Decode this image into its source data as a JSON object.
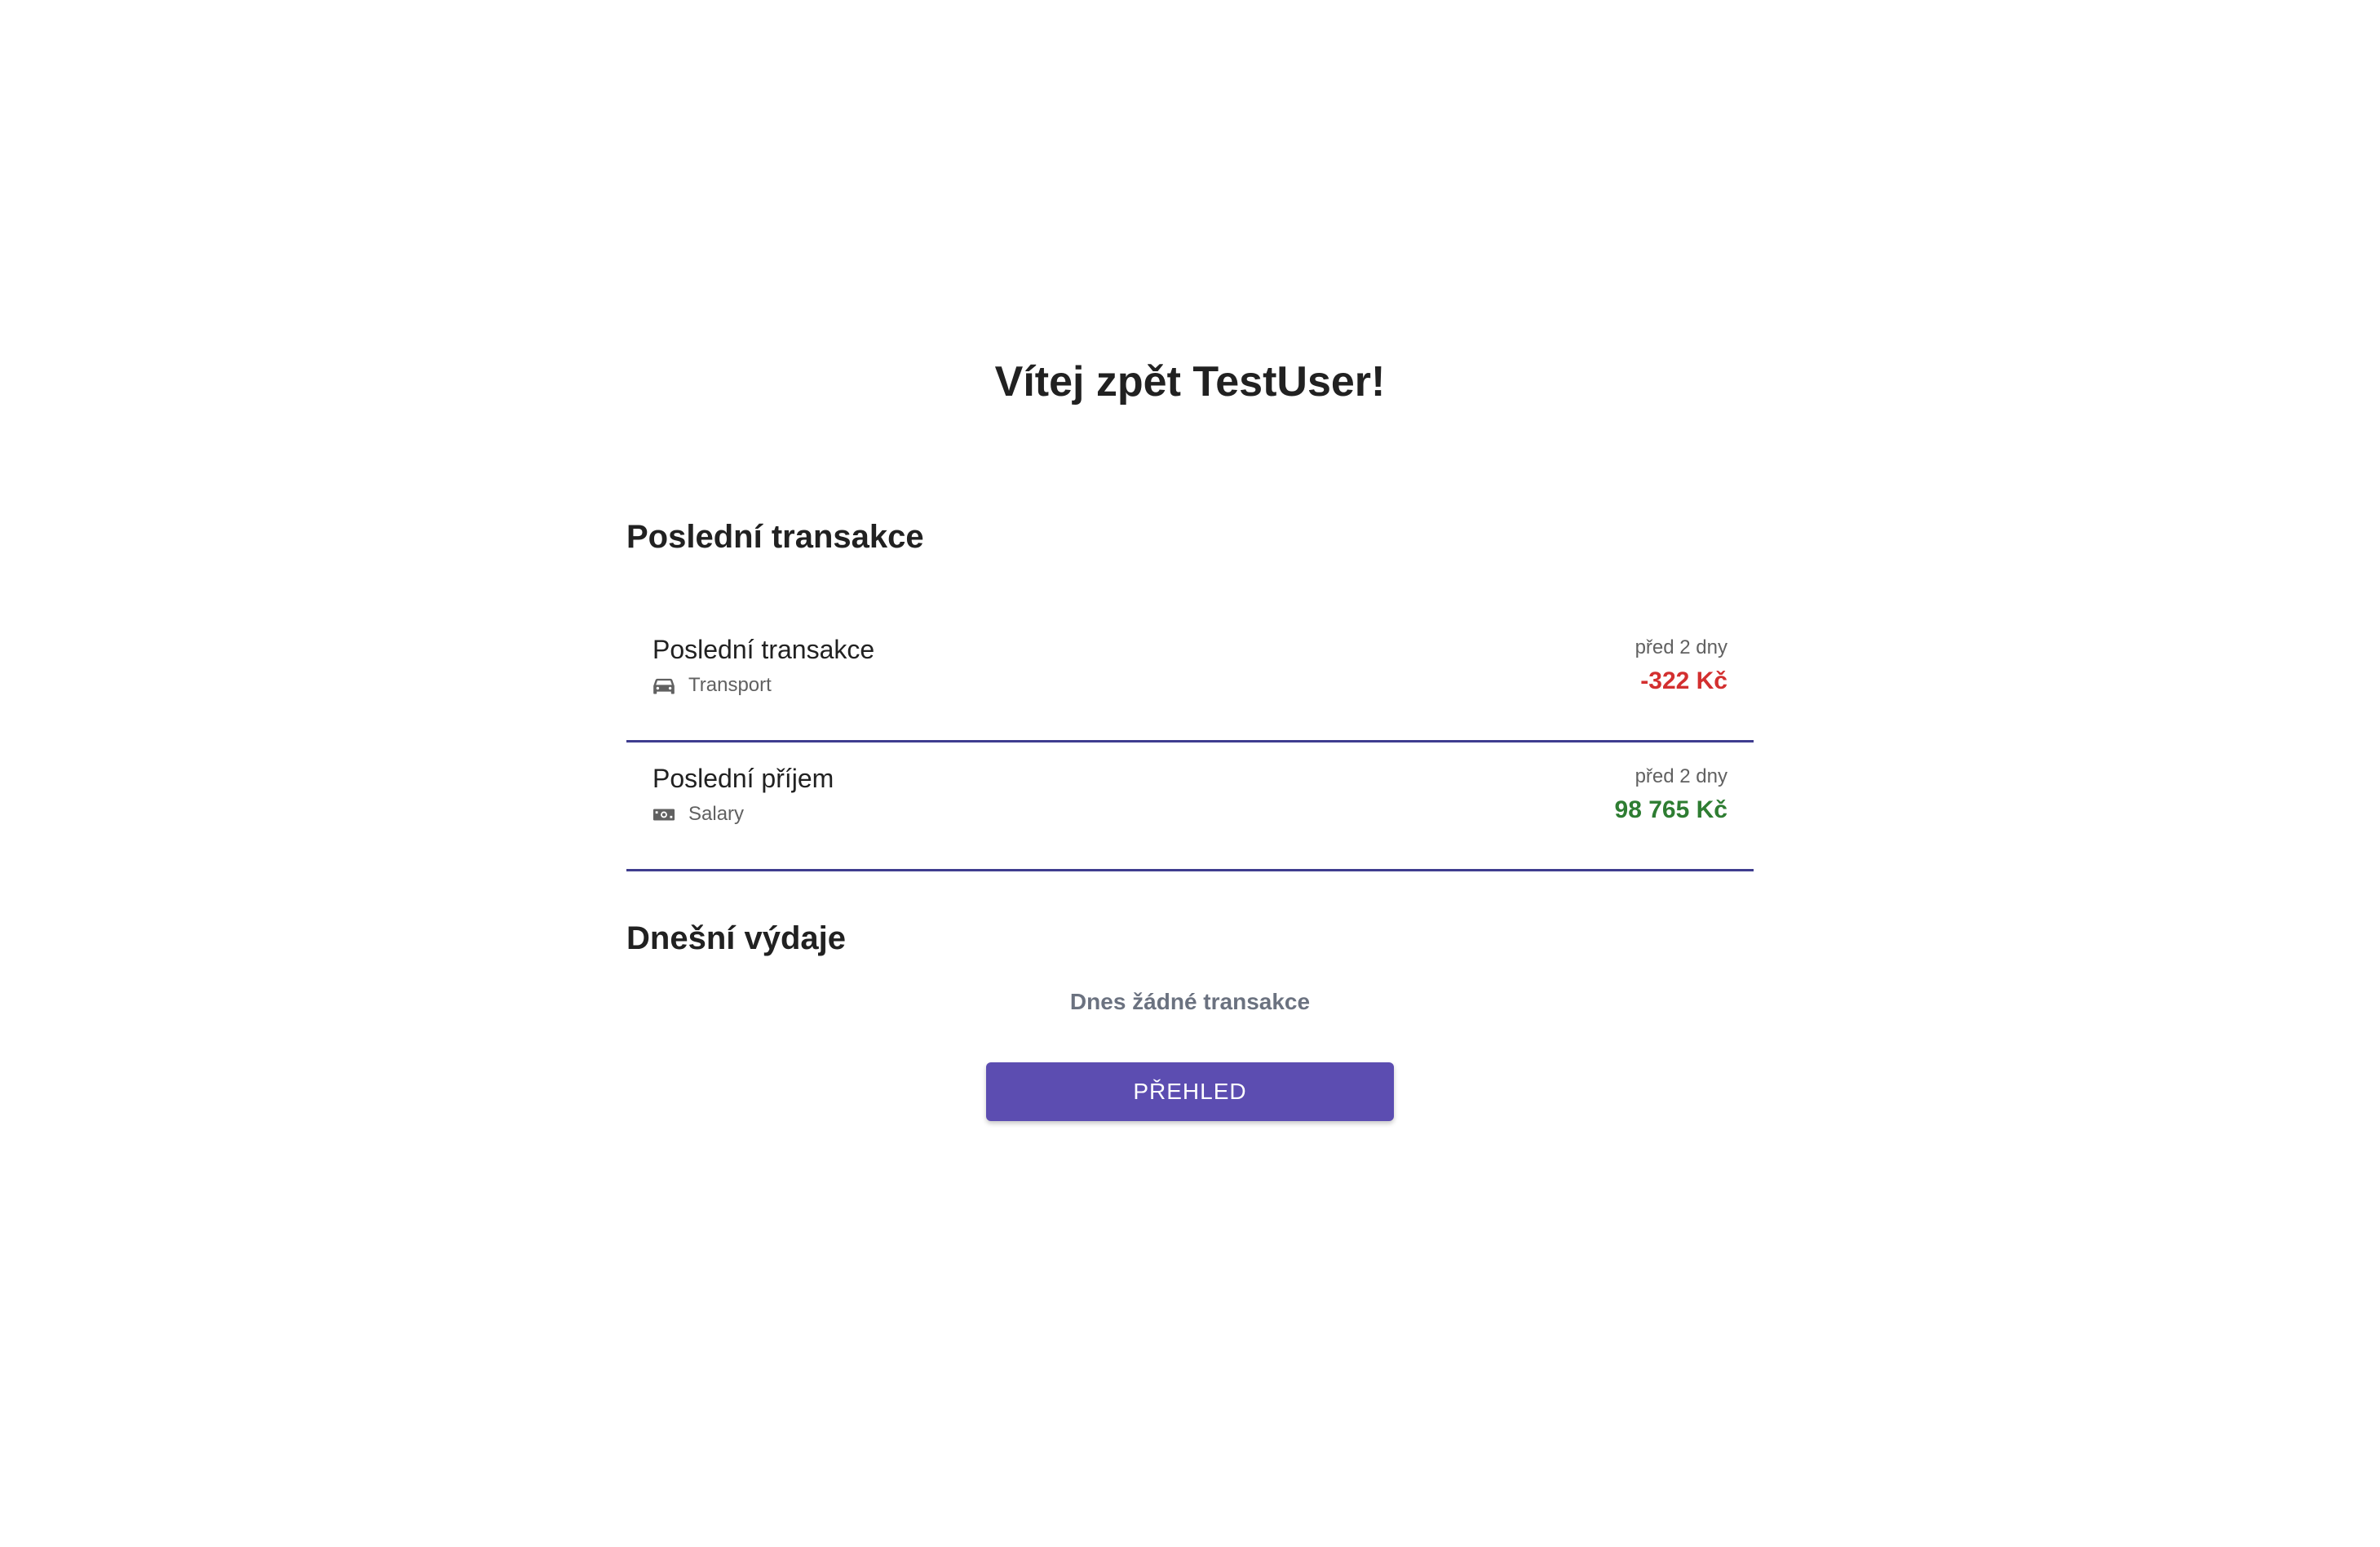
{
  "header": {
    "welcome": "Vítej zpět TestUser!"
  },
  "recent": {
    "title": "Poslední transakce",
    "items": [
      {
        "title": "Poslední transakce",
        "category": "Transport",
        "category_icon": "car-icon",
        "time": "před 2 dny",
        "amount": "-322 Kč",
        "amount_color": "#d32f2f"
      },
      {
        "title": "Poslední příjem",
        "category": "Salary",
        "category_icon": "money-icon",
        "time": "před 2 dny",
        "amount": "98 765 Kč",
        "amount_color": "#2e7d32"
      }
    ]
  },
  "today": {
    "title": "Dnešní výdaje",
    "empty_message": "Dnes žádné transakce"
  },
  "actions": {
    "overview_label": "PŘEHLED"
  },
  "colors": {
    "accent": "#5c4db1",
    "divider": "#3f3d8f",
    "negative": "#d32f2f",
    "positive": "#2e7d32"
  }
}
